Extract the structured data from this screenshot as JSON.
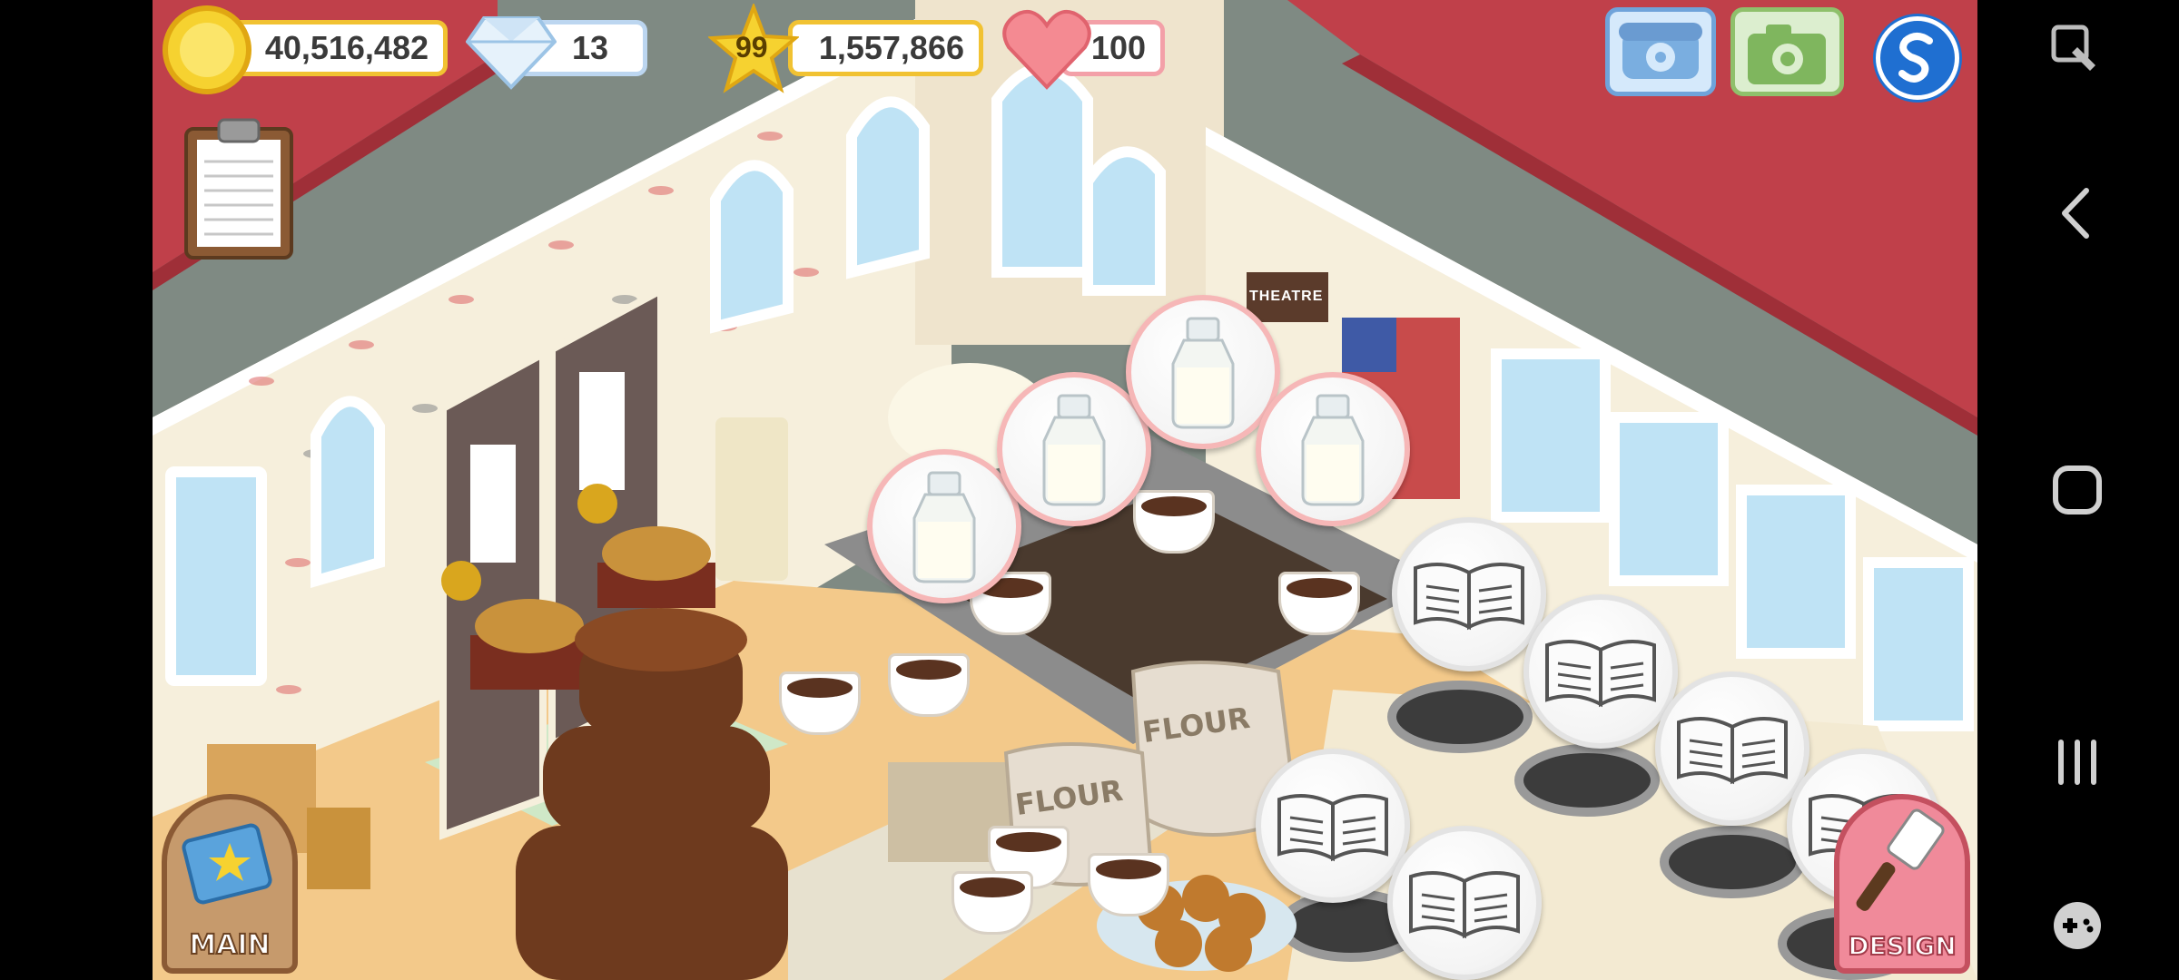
{
  "hud": {
    "coins": "40,516,482",
    "gems": "13",
    "level": "99",
    "experience": "1,557,866",
    "hearts": "100"
  },
  "buttons": {
    "main_label": "MAIN",
    "design_label": "DESIGN"
  },
  "signs": {
    "theatre": "THEATRE",
    "flour_1": "FLOUR",
    "flour_2": "FLOUR"
  },
  "colors": {
    "wall": "#f6efdc",
    "floor": "#f3c98a",
    "roof": "#c0404a",
    "counter": "#4a3a2e",
    "accent_gold": "#f1c232",
    "bubble_border": "#f6b7b7",
    "design_button": "#f08a9a",
    "main_button": "#c69a6c"
  },
  "icons": {
    "coin": "coin-icon",
    "gem": "diamond-icon",
    "level": "star-icon",
    "heart": "heart-icon",
    "phone": "phone-icon",
    "camera": "camera-icon",
    "social": "social-s-icon",
    "recipe": "clipboard-icon",
    "milk": "milk-bottle-icon",
    "book": "open-book-icon",
    "screenshot": "screenshot-icon",
    "back": "back-icon",
    "home": "home-icon",
    "recents": "recents-icon",
    "game_tools": "gamepad-icon"
  }
}
